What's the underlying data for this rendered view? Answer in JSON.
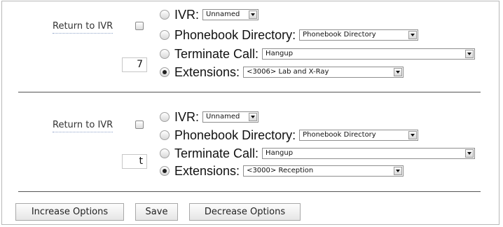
{
  "options": [
    {
      "return_label": "Return to IVR",
      "number": "7",
      "rows": {
        "ivr": {
          "label": "IVR:",
          "value": "Unnamed"
        },
        "phonebook": {
          "label": "Phonebook Directory:",
          "value": "Phonebook Directory"
        },
        "terminate": {
          "label": "Terminate Call:",
          "value": "Hangup"
        },
        "extensions": {
          "label": "Extensions:",
          "value": "<3006> Lab and X-Ray"
        }
      },
      "selected": "extensions",
      "return_checked": false
    },
    {
      "return_label": "Return to IVR",
      "number": "t",
      "rows": {
        "ivr": {
          "label": "IVR:",
          "value": "Unnamed"
        },
        "phonebook": {
          "label": "Phonebook Directory:",
          "value": "Phonebook Directory"
        },
        "terminate": {
          "label": "Terminate Call:",
          "value": "Hangup"
        },
        "extensions": {
          "label": "Extensions:",
          "value": "<3000> Reception"
        }
      },
      "selected": "extensions",
      "return_checked": false
    }
  ],
  "buttons": {
    "increase": "Increase Options",
    "save": "Save",
    "decrease": "Decrease Options"
  }
}
